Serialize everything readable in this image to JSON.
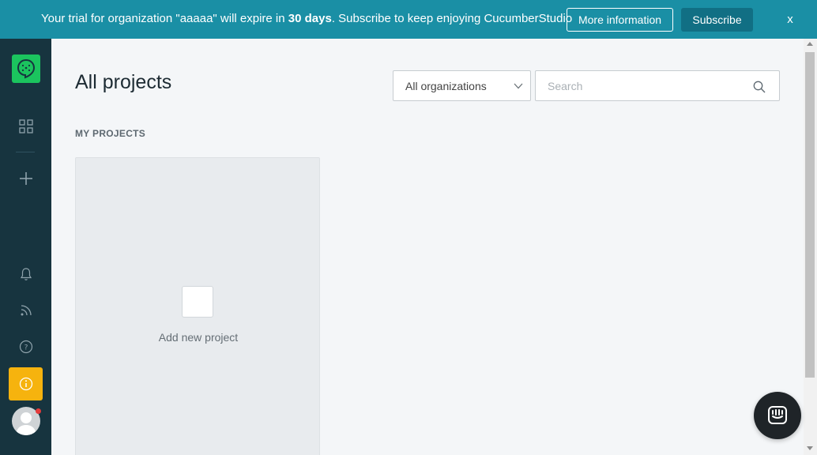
{
  "banner": {
    "text_prefix": "Your trial for organization \"aaaaa\" will expire in ",
    "text_bold": "30 days",
    "text_suffix": ". Subscribe to keep enjoying CucumberStudio",
    "more_info_label": "More information",
    "subscribe_label": "Subscribe",
    "close_label": "x",
    "background_color": "#1a8fa5"
  },
  "sidebar": {
    "background_color": "#17343f",
    "logo": "cucumber-logo",
    "items": [
      {
        "icon": "grid-icon",
        "name": "projects"
      },
      {
        "icon": "plus-icon",
        "name": "new-project"
      },
      {
        "icon": "bell-icon",
        "name": "notifications"
      },
      {
        "icon": "rss-icon",
        "name": "feed"
      },
      {
        "icon": "help-icon",
        "name": "help"
      },
      {
        "icon": "info-icon",
        "name": "trial-info",
        "color": "#f6b30e"
      },
      {
        "icon": "avatar",
        "name": "user"
      }
    ]
  },
  "main": {
    "page_title": "All projects",
    "org_filter": {
      "selected": "All organizations"
    },
    "search": {
      "placeholder": "Search",
      "value": ""
    },
    "section_label": "MY PROJECTS",
    "add_project_label": "Add new project"
  }
}
